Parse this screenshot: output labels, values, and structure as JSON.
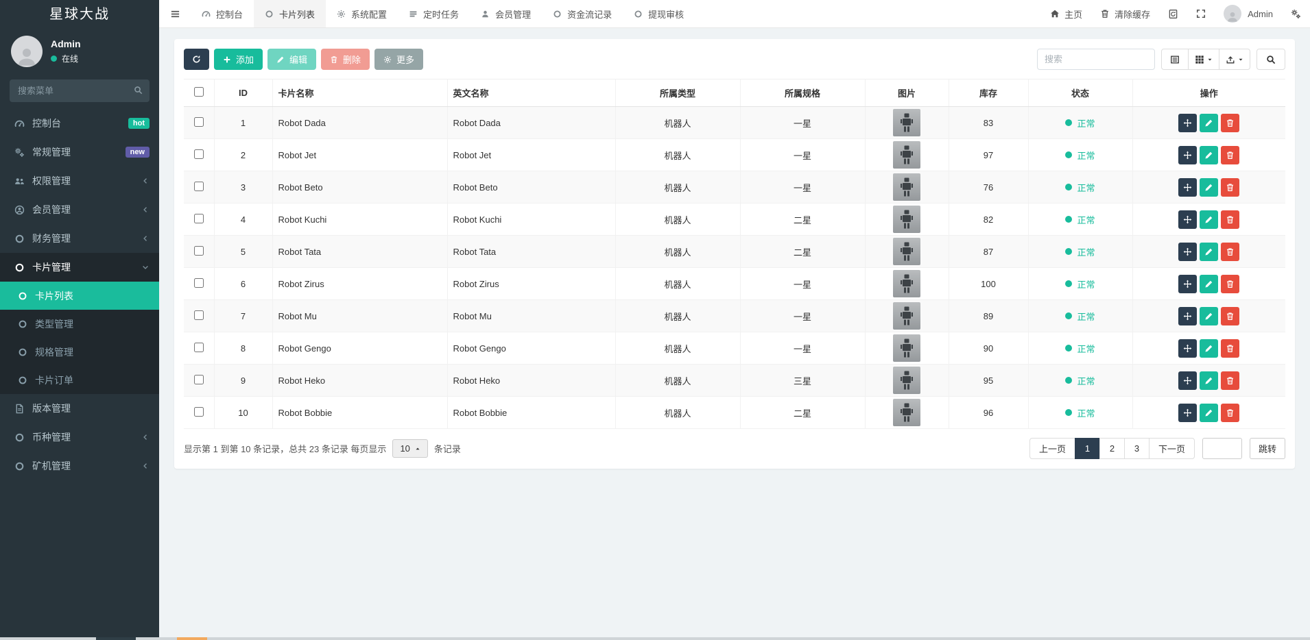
{
  "colors": {
    "sidebar_bg": "#28343b",
    "sidebar_open_bg": "#20282d",
    "accent_teal": "#18bc9c",
    "primary_dark": "#2c3e50",
    "danger_red": "#e74c3c",
    "more_gray": "#95a5a6",
    "badge_hot": "#18bc9c",
    "badge_new": "#605ca8",
    "status_ok": "#18bc9c"
  },
  "sidebar": {
    "brand": "星球大战",
    "user": {
      "name": "Admin",
      "status": "在线"
    },
    "search_placeholder": "搜索菜单",
    "menu": [
      {
        "key": "console",
        "label": "控制台",
        "icon": "gauge",
        "badge": {
          "text": "hot",
          "color": "#18bc9c"
        }
      },
      {
        "key": "general",
        "label": "常规管理",
        "icon": "gears",
        "badge": {
          "text": "new",
          "color": "#605ca8"
        }
      },
      {
        "key": "permissions",
        "label": "权限管理",
        "icon": "users",
        "chevron": "left"
      },
      {
        "key": "members",
        "label": "会员管理",
        "icon": "user-circle",
        "chevron": "left"
      },
      {
        "key": "finance",
        "label": "财务管理",
        "icon": "circle",
        "chevron": "left"
      },
      {
        "key": "cards",
        "label": "卡片管理",
        "icon": "circle",
        "chevron": "down",
        "open": true,
        "children": [
          {
            "key": "card-list",
            "label": "卡片列表",
            "icon": "circle",
            "active": true
          },
          {
            "key": "type-management",
            "label": "类型管理",
            "icon": "circle"
          },
          {
            "key": "spec-management",
            "label": "规格管理",
            "icon": "circle"
          },
          {
            "key": "card-orders",
            "label": "卡片订单",
            "icon": "circle"
          }
        ]
      },
      {
        "key": "version",
        "label": "版本管理",
        "icon": "file"
      },
      {
        "key": "currency",
        "label": "币种管理",
        "icon": "circle",
        "chevron": "left"
      },
      {
        "key": "miner",
        "label": "矿机管理",
        "icon": "circle",
        "chevron": "left"
      }
    ]
  },
  "topnav": {
    "tabs": [
      {
        "key": "console",
        "label": "控制台",
        "icon": "gauge"
      },
      {
        "key": "card-list",
        "label": "卡片列表",
        "icon": "circle",
        "active": true
      },
      {
        "key": "system-config",
        "label": "系统配置",
        "icon": "gear"
      },
      {
        "key": "cron-tasks",
        "label": "定时任务",
        "icon": "tasks"
      },
      {
        "key": "members",
        "label": "会员管理",
        "icon": "user"
      },
      {
        "key": "fund-records",
        "label": "资金流记录",
        "icon": "circle"
      },
      {
        "key": "withdraw-audit",
        "label": "提现审核",
        "icon": "circle"
      }
    ],
    "right": {
      "home": "主页",
      "clear_cache": "清除缓存",
      "username": "Admin"
    }
  },
  "toolbar": {
    "add": "添加",
    "edit": "编辑",
    "delete": "删除",
    "more": "更多",
    "search_placeholder": "搜索"
  },
  "table": {
    "headers": [
      "ID",
      "卡片名称",
      "英文名称",
      "所属类型",
      "所属规格",
      "图片",
      "库存",
      "状态",
      "操作"
    ],
    "rows": [
      {
        "id": 1,
        "name": "Robot Dada",
        "en_name": "Robot Dada",
        "type": "机器人",
        "spec": "一星",
        "image": "robot-thumbnail",
        "stock": 83,
        "status": "正常"
      },
      {
        "id": 2,
        "name": "Robot Jet",
        "en_name": "Robot Jet",
        "type": "机器人",
        "spec": "一星",
        "image": "robot-thumbnail",
        "stock": 97,
        "status": "正常"
      },
      {
        "id": 3,
        "name": "Robot Beto",
        "en_name": "Robot Beto",
        "type": "机器人",
        "spec": "一星",
        "image": "robot-thumbnail",
        "stock": 76,
        "status": "正常"
      },
      {
        "id": 4,
        "name": "Robot Kuchi",
        "en_name": "Robot Kuchi",
        "type": "机器人",
        "spec": "二星",
        "image": "robot-thumbnail",
        "stock": 82,
        "status": "正常"
      },
      {
        "id": 5,
        "name": "Robot Tata",
        "en_name": "Robot Tata",
        "type": "机器人",
        "spec": "二星",
        "image": "robot-thumbnail",
        "stock": 87,
        "status": "正常"
      },
      {
        "id": 6,
        "name": "Robot Zirus",
        "en_name": "Robot Zirus",
        "type": "机器人",
        "spec": "一星",
        "image": "robot-thumbnail",
        "stock": 100,
        "status": "正常"
      },
      {
        "id": 7,
        "name": "Robot Mu",
        "en_name": "Robot Mu",
        "type": "机器人",
        "spec": "一星",
        "image": "robot-thumbnail",
        "stock": 89,
        "status": "正常"
      },
      {
        "id": 8,
        "name": "Robot Gengo",
        "en_name": "Robot Gengo",
        "type": "机器人",
        "spec": "一星",
        "image": "robot-thumbnail",
        "stock": 90,
        "status": "正常"
      },
      {
        "id": 9,
        "name": "Robot Heko",
        "en_name": "Robot Heko",
        "type": "机器人",
        "spec": "三星",
        "image": "robot-thumbnail",
        "stock": 95,
        "status": "正常"
      },
      {
        "id": 10,
        "name": "Robot Bobbie",
        "en_name": "Robot Bobbie",
        "type": "机器人",
        "spec": "二星",
        "image": "robot-thumbnail",
        "stock": 96,
        "status": "正常"
      }
    ]
  },
  "pagination": {
    "summary_prefix": "显示第 1 到第 10 条记录，总共 23 条记录 每页显示",
    "page_size": "10",
    "summary_suffix": "条记录",
    "prev": "上一页",
    "pages": [
      "1",
      "2",
      "3"
    ],
    "active_page": "1",
    "next": "下一页",
    "jump_input_value": "",
    "jump": "跳转"
  }
}
